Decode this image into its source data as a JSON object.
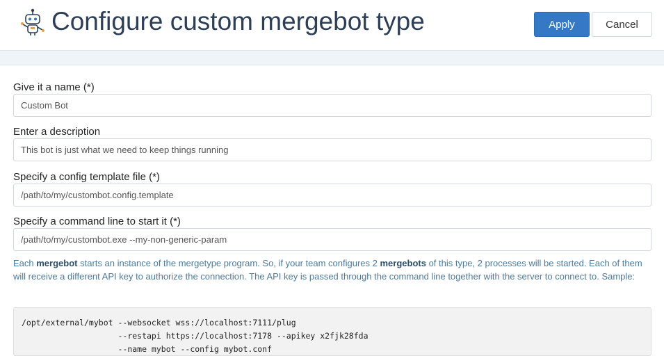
{
  "header": {
    "title": "Configure custom mergebot type",
    "apply_label": "Apply",
    "cancel_label": "Cancel",
    "icon": "robot-icon"
  },
  "form": {
    "name": {
      "label": "Give it a name (*)",
      "value": "Custom Bot"
    },
    "description": {
      "label": "Enter a description",
      "value": "This bot is just what we need to keep things running"
    },
    "config_template": {
      "label": "Specify a config template file (*)",
      "value": "/path/to/my/custombot.config.template"
    },
    "command_line": {
      "label": "Specify a command line to start it (*)",
      "value": "/path/to/my/custombot.exe --my-non-generic-param"
    }
  },
  "help": {
    "part1": "Each ",
    "bold1": "mergebot",
    "part2": " starts an instance of the mergetype program. So, if your team configures 2 ",
    "bold2": "mergebots",
    "part3": " of this type, 2 processes will be started. Each of them will receive a different API key to authorize the connection. The API key is passed through the command line together with the server to connect to. Sample:"
  },
  "sample": {
    "lines": [
      "/opt/external/mybot --websocket wss://localhost:7111/plug",
      "                    --restapi https://localhost:7178 --apikey x2fjk28fda",
      "                    --name mybot --config mybot.conf"
    ]
  },
  "colors": {
    "accent": "#3478c6",
    "title": "#2e3f55",
    "help_text": "#4f7a96"
  }
}
